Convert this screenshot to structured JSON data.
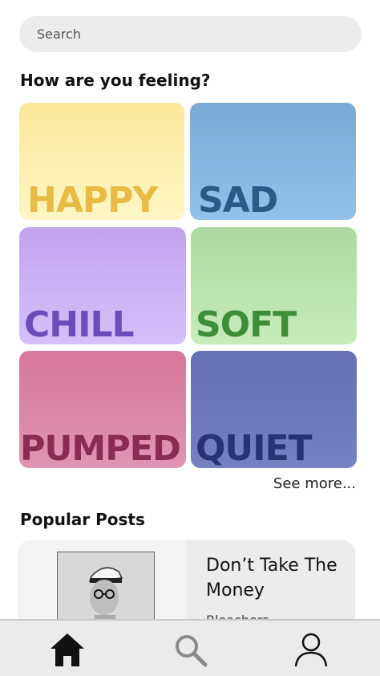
{
  "search": {
    "placeholder": "Search"
  },
  "feelings": {
    "title": "How are you feeling?",
    "moods": [
      {
        "label": "HAPPY",
        "bg_top": "#fde89b",
        "bg_bottom": "#fdf6c4",
        "text_color": "#e7bb45"
      },
      {
        "label": "SAD",
        "bg_top": "#7aaad3",
        "bg_bottom": "#92c2ea",
        "text_color": "#2b5a85"
      },
      {
        "label": "CHILL",
        "bg_top": "#c0a3ee",
        "bg_bottom": "#d5c0fa",
        "text_color": "#6c4cb8"
      },
      {
        "label": "SOFT",
        "bg_top": "#add99f",
        "bg_bottom": "#c6ecba",
        "text_color": "#3f8c3a"
      },
      {
        "label": "PUMPED",
        "bg_top": "#d7779b",
        "bg_bottom": "#e194b3",
        "text_color": "#8a2b53"
      },
      {
        "label": "QUIET",
        "bg_top": "#6670b6",
        "bg_bottom": "#7580c3",
        "text_color": "#2a3275"
      }
    ],
    "see_more": "See more..."
  },
  "popular": {
    "title": "Popular Posts",
    "post": {
      "title": "Don’t Take The Money",
      "artist": "Bleachers"
    }
  },
  "nav": {
    "items": [
      "home-icon",
      "search-icon",
      "profile-icon"
    ]
  }
}
